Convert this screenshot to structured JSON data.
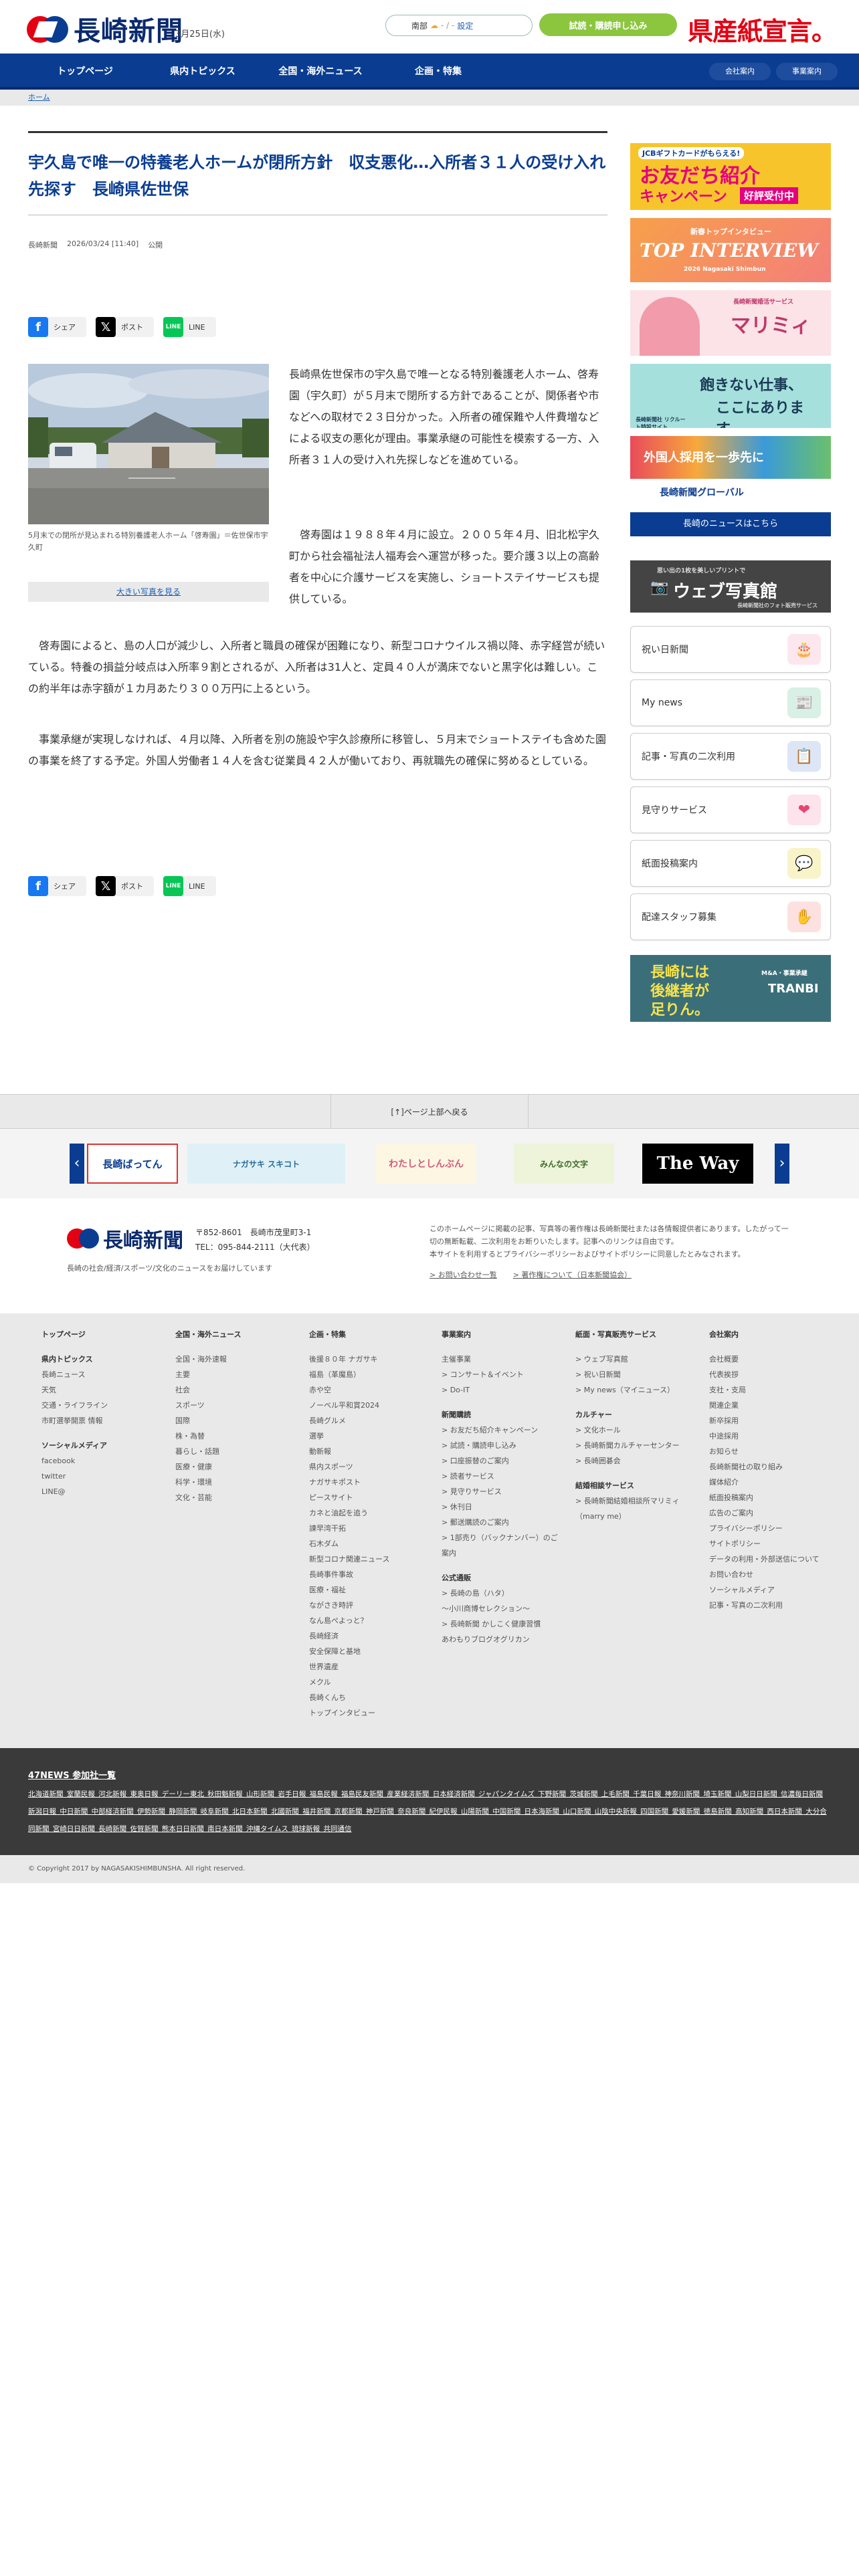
{
  "header": {
    "logo": "長崎新聞",
    "date": "3月25日(水)",
    "weather": {
      "location": "南部",
      "value": "- / -",
      "settings": "設定"
    },
    "subscribe": "試読・購読申し込み",
    "kensan": "県産紙宣言。"
  },
  "gnav": {
    "items": [
      "トップページ",
      "県内トピックス",
      "全国・海外ニュース",
      "企画・特集"
    ],
    "pills": [
      "会社案内",
      "事業案内"
    ]
  },
  "breadcrumb": "ホーム",
  "article": {
    "title": "宇久島で唯一の特養老人ホームが閉所方針　収支悪化…入所者３１人の受け入れ先探す　長崎県佐世保",
    "source": "長崎新聞",
    "datetime": "2026/03/24 [11:40]",
    "status": "公開",
    "share": {
      "facebook": "シェア",
      "x": "ポスト",
      "line": "LINE",
      "line_icon": "LINE"
    },
    "photo_caption": "5月末での閉所が見込まれる特別養護老人ホーム「啓寿園」＝佐世保市宇久町",
    "enlarge": "大きい写真を見る",
    "paragraphs": [
      "長崎県佐世保市の宇久島で唯一となる特別養護老人ホーム、啓寿園（宇久町）が５月末で閉所する方針であることが、関係者や市などへの取材で２３日分かった。入所者の確保難や人件費増などによる収支の悪化が理由。事業承継の可能性を模索する一方、入所者３１人の受け入れ先探しなどを進めている。",
      "　啓寿園は１９８８年４月に設立。２００５年４月、旧北松宇久町から社会福祉法人福寿会へ運営が移った。要介護３以上の高齢者を中心に介護サービスを実施し、ショートステイサービスも提供している。",
      "　啓寿園によると、島の人口が減少し、入所者と職員の確保が困難になり、新型コロナウイルス禍以降、赤字経営が続いている。特養の損益分岐点は入所率９割とされるが、入所者は31人と、定員４０人が満床でないと黒字化は難しい。この約半年は赤字額が１カ月あたり３００万円に上るという。",
      "　事業承継が実現しなければ、４月以降、入所者を別の施設や宇久診療所に移管し、５月末でショートステイも含めた園の事業を終了する予定。外国人労働者１４人を含む従業員４２人が働いており、再就職先の確保に努めるとしている。"
    ]
  },
  "sidebar": {
    "banners": [
      {
        "name": "jcb-friend-campaign-banner",
        "l1": "JCBギフトカードがもらえる!",
        "l2": "お友だち紹介",
        "l3": "キャンペーン",
        "l4": "好評受付中"
      },
      {
        "name": "top-interview-banner",
        "l1": "新春トップインタビュー",
        "l2": "TOP INTERVIEW",
        "l3": "2026 Nagasaki Shimbun"
      },
      {
        "name": "marimie-banner",
        "l1": "マリミィ",
        "l2": "長崎新聞婚活サービス"
      },
      {
        "name": "recruit-banner",
        "l1": "飽きない仕事、",
        "l2": "ここにあります。",
        "l3": "長崎新聞社 リクルート特設サイト"
      },
      {
        "name": "global-banner",
        "l1": "外国人採用を一歩先に",
        "l2": "長崎新聞グローバル"
      }
    ],
    "more_news": "長崎のニュースはこちら",
    "photo_banner": {
      "l1": "思い出の1枚を美しいプリントで",
      "l2": "ウェブ写真館",
      "l3": "長崎新聞社のフォト販売サービス"
    },
    "services": [
      {
        "label": "祝い日新聞",
        "icon": "🎂",
        "color": "#fde7ee"
      },
      {
        "label": "My news",
        "icon": "📰",
        "color": "#d8f0e6"
      },
      {
        "label": "記事・写真の二次利用",
        "icon": "📋",
        "color": "#dde6f5"
      },
      {
        "label": "見守りサービス",
        "icon": "❤",
        "color": "#fde3ec"
      },
      {
        "label": "紙面投稿案内",
        "icon": "💬",
        "color": "#f9f3c9"
      },
      {
        "label": "配達スタッフ募集",
        "icon": "✋",
        "color": "#fde1e1"
      }
    ],
    "successor_banner": {
      "l1": "長崎には",
      "l2": "後継者が",
      "l3": "足りん。",
      "l4": "M&A・事業承継",
      "l5": "TRANBI"
    }
  },
  "back_to_top": "[↑]ページ上部へ戻る",
  "carousel": {
    "prev": "‹",
    "next": "›",
    "slides": [
      "長崎ばってん",
      "ナガサキ スキコト",
      "わたしとしんぶん",
      "みんなの文字",
      "The Way"
    ]
  },
  "footer": {
    "logo": "長崎新聞",
    "address": [
      "〒852-8601　長崎市茂里町3-1",
      "TEL：095-844-2111（大代表）"
    ],
    "desc": "長崎の社会/経済/スポーツ/文化のニュースをお届けしています",
    "copyright_note": "このホームページに掲載の記事、写真等の著作権は長崎新聞社または各情報提供者にあります。したがって一切の無断転載、二次利用をお断りいたします。記事へのリンクは自由です。",
    "policy_pre": "本サイトを利用するとプライバシーポリシーおよびサイトポリシーに同意したとみなされます。",
    "links": [
      "> お問い合わせ一覧",
      "> 著作権について（日本新聞協会）"
    ]
  },
  "sitemap": {
    "col1": {
      "h": "トップページ",
      "sh1": "県内トピックス",
      "items1": [
        "長崎ニュース",
        "天気",
        "交通・ライフライン",
        "市町選挙開票 情報"
      ],
      "sh2": "ソーシャルメディア",
      "items2": [
        "facebook",
        "twitter",
        "LINE@"
      ]
    },
    "col2": {
      "h": "全国・海外ニュース",
      "items": [
        "全国・海外速報",
        "主要",
        "社会",
        "スポーツ",
        "国際",
        "株・為替",
        "暮らし・話題",
        "医療・健康",
        "科学・環境",
        "文化・芸能"
      ]
    },
    "col3": {
      "h": "企画・特集",
      "items": [
        "後援８０年 ナガサキ",
        "福島（革魔島）",
        "赤や空",
        "ノーベル平和賞2024",
        "長崎グルメ",
        "選挙",
        "動新報",
        "県内スポーツ",
        "ナガサキポスト",
        "ピースサイト",
        "カネと油起を追う",
        "諫早湾干拓",
        "石木ダム",
        "新型コロナ関連ニュース",
        "長崎事件事故",
        "医療・福祉",
        "ながさき時評",
        "なん島ぺよっと？",
        "長崎経済",
        "安全保障と基地",
        "世界遺産",
        "メクル",
        "長崎くんち",
        "トップインタビュー"
      ]
    },
    "col4": {
      "h": "事業案内",
      "sub1": "主催事業",
      "items1": [
        "> コンサート＆イベント",
        "> Do-IT"
      ],
      "sub2": "新聞購読",
      "items2": [
        "> お友だち紹介キャンペーン",
        "> 試読・購読申し込み",
        "> 口座振替のご案内",
        "> 読者サービス",
        "> 見守りサービス",
        "> 休刊日",
        "> 郵送購読のご案内",
        "> 1部売り（バックナンバー）のご案内"
      ],
      "sub3": "公式通販",
      "items3": [
        "> 長崎の島（ハタ）",
        "〜小川商博セレクション〜",
        "> 長崎新聞 かしこく健康習慣",
        "あわもりブログオグリカン"
      ]
    },
    "col5": {
      "h": "紙面・写真販売サービス",
      "items1": [
        "> ウェブ写真館",
        "> 祝い日新聞",
        "> My news（マイニュース）"
      ],
      "sub2": "カルチャー",
      "items2": [
        "> 文化ホール",
        "> 長崎新聞カルチャーセンター",
        "> 長崎囲碁会"
      ],
      "sub3": "結婚相談サービス",
      "items3": [
        "> 長崎新聞結婚相談所マリミィ（marry me）"
      ]
    },
    "col6": {
      "h": "会社案内",
      "items": [
        "会社概要",
        "代表挨拶",
        "支社・支局",
        "関連企業",
        "新卒採用",
        "中途採用",
        "お知らせ",
        "長崎新聞社の取り組み",
        "媒体紹介",
        "紙面投稿案内",
        "広告のご案内",
        "プライバシーポリシー",
        "サイトポリシー",
        "データの利用・外部送信について",
        "お問い合わせ",
        "ソーシャルメディア",
        "記事・写真の二次利用"
      ]
    }
  },
  "news47": {
    "title": "47NEWS 参加社一覧",
    "papers": "北海道新聞 室蘭民報 河北新報 東奥日報 デーリー東北 秋田魁新報 山形新聞 岩手日報 福島民報 福島民友新聞 産業経済新聞 日本経済新聞 ジャパンタイムズ 下野新聞 茨城新聞 上毛新聞 千葉日報 神奈川新聞 埼玉新聞 山梨日日新聞 信濃毎日新聞 新潟日報 中日新聞 中部経済新聞 伊勢新聞 静岡新聞 岐阜新聞 北日本新聞 北國新聞 福井新聞 京都新聞 神戸新聞 奈良新聞 紀伊民報 山陽新聞 中国新聞 日本海新聞 山口新聞 山陰中央新報 四国新聞 愛媛新聞 徳島新聞 高知新聞 西日本新聞 大分合同新聞 宮崎日日新聞 長崎新聞 佐賀新聞 熊本日日新聞 南日本新聞 沖縄タイムス 琉球新報 共同通信"
  },
  "copyright": "© Copyright 2017 by NAGASAKISHIMBUNSHA. All right reserved."
}
